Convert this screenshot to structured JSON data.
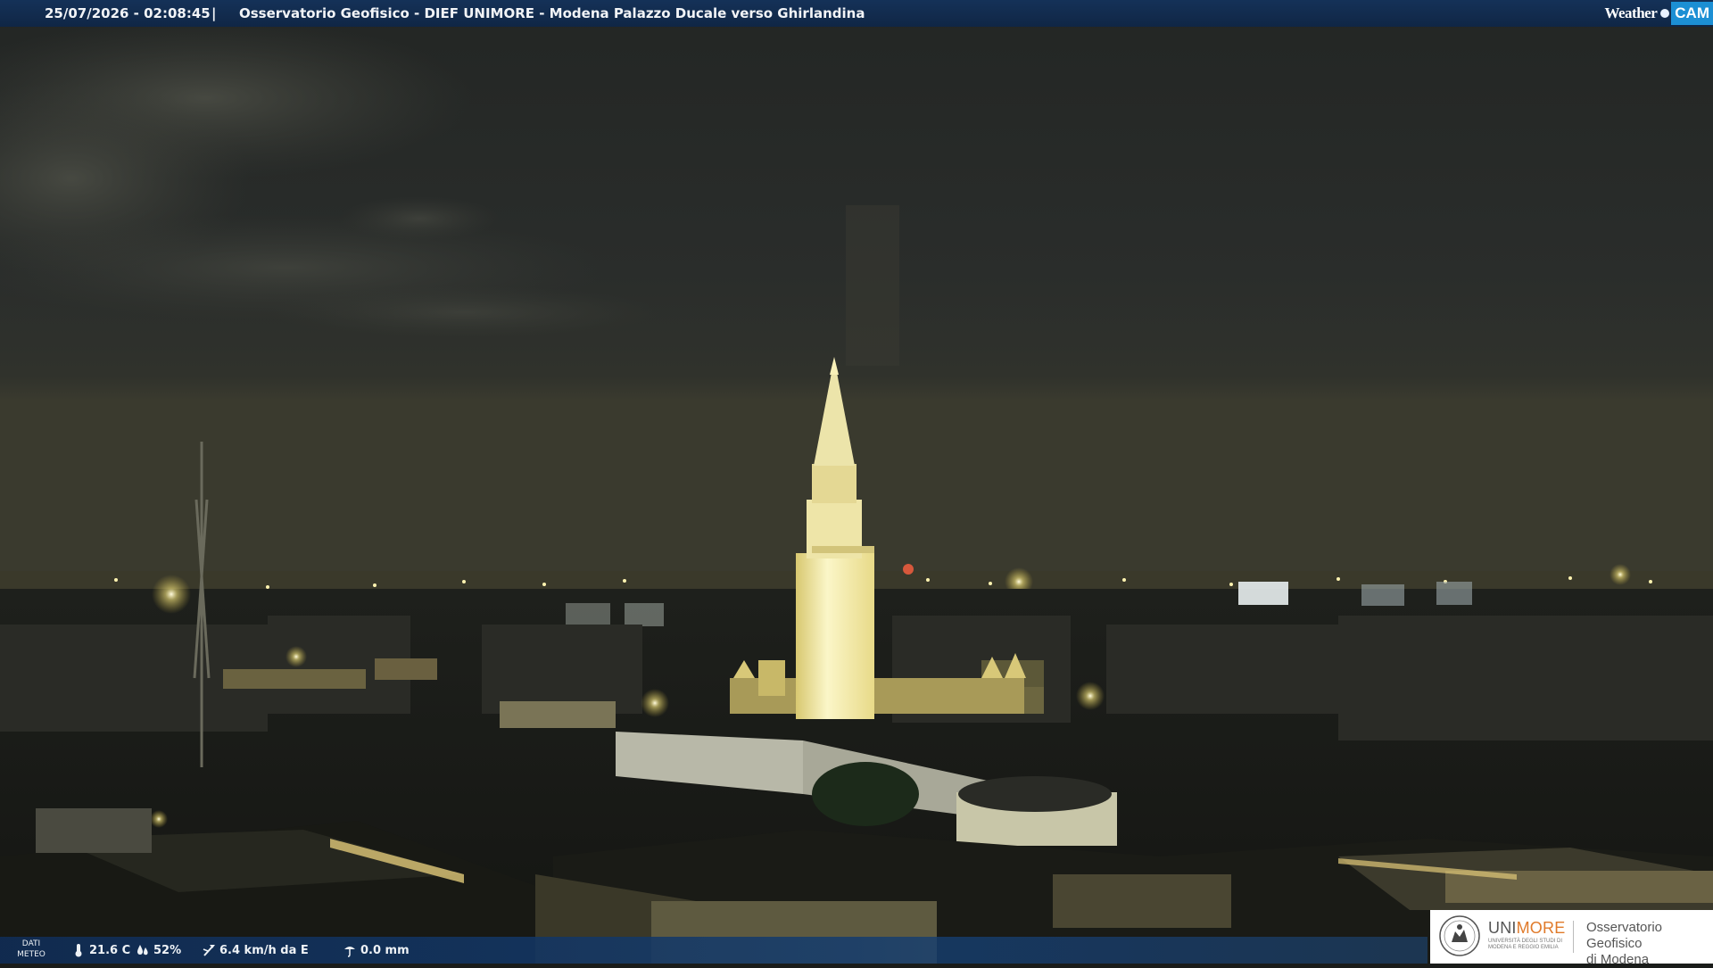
{
  "overlay": {
    "datetime": "25/07/2026 - 02:08:45",
    "separator": "|",
    "title": "Osservatorio Geofisico - DIEF UNIMORE - Modena Palazzo Ducale verso Ghirlandina"
  },
  "brand": {
    "weather": "Weather",
    "cam": "CAM"
  },
  "meteo": {
    "label_line1": "DATI",
    "label_line2": "METEO",
    "temperature": "21.6 C",
    "humidity": "52%",
    "wind": "6.4 km/h da E",
    "rain": "0.0 mm",
    "icons": [
      "thermometer-icon",
      "humidity-drops-icon",
      "wind-vane-icon",
      "rain-gauge-icon"
    ]
  },
  "logo": {
    "uni": "UNI",
    "more": "MORE",
    "subtitle": "UNIVERSITÀ DEGLI STUDI DI MODENA E REGGIO EMILIA",
    "observatory_line1": "Osservatorio Geofisico",
    "observatory_line2": "di Modena"
  },
  "colors": {
    "overlay_bar": "#143a6a",
    "cam_badge": "#1c8fd4",
    "unimore_orange": "#e07a2a",
    "tower_light": "#f8f0b0"
  }
}
